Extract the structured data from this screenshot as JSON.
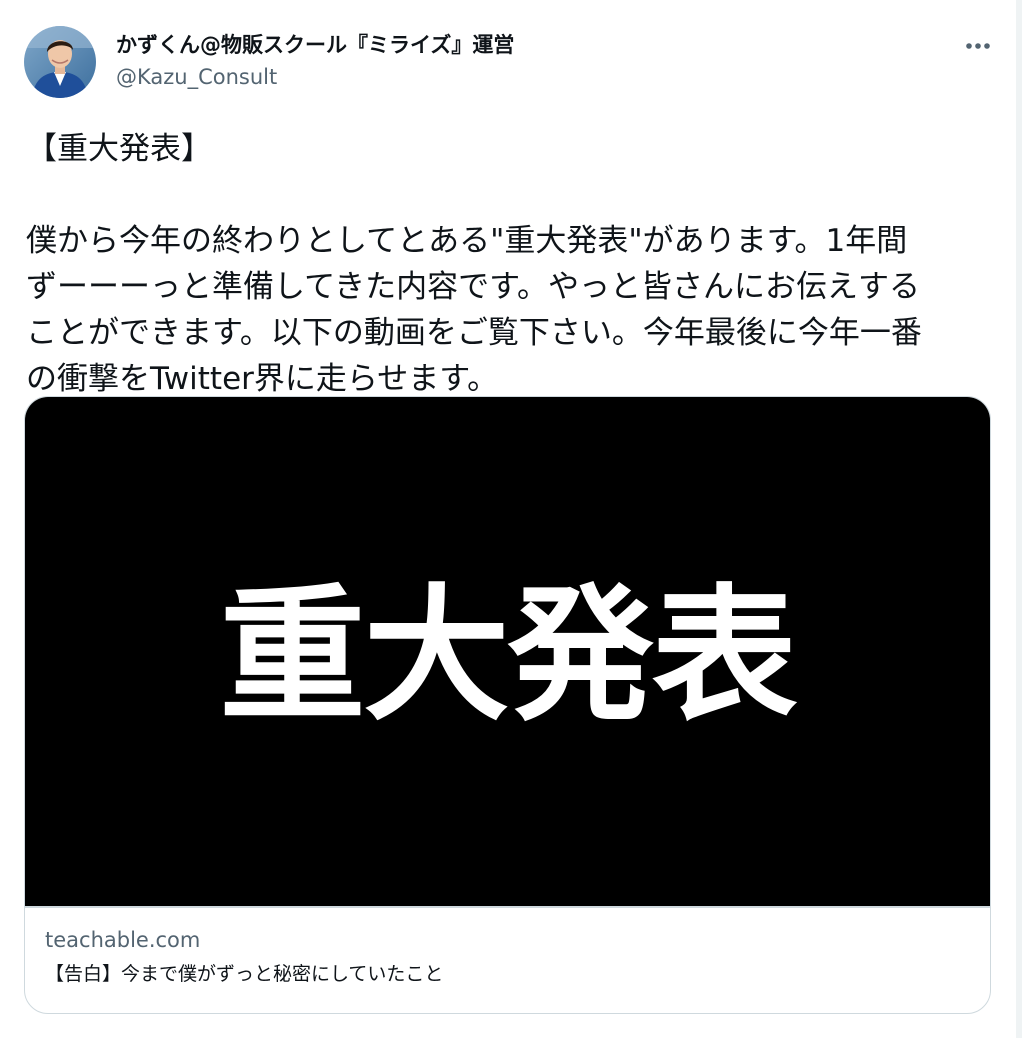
{
  "author": {
    "display_name": "かずくん@物販スクール『ミライズ』運営",
    "handle": "@Kazu_Consult",
    "avatar_icon": "profile-photo"
  },
  "more_icon": "more-horizontal-icon",
  "tweet": {
    "heading": "【重大発表】",
    "body": "僕から今年の終わりとしてとある\"重大発表\"があります。1年間\nずーーーっと準備してきた内容です。やっと皆さんにお伝えする\nことができます。以下の動画をご覧下さい。今年最後に今年一番\nの衝撃をTwitter界に走らせます。"
  },
  "card": {
    "media_text": "重大発表",
    "domain": "teachable.com",
    "title": "【告白】今まで僕がずっと秘密にしていたこと"
  },
  "colors": {
    "text_primary": "#0f1419",
    "text_secondary": "#536471",
    "border": "#cfd9de",
    "media_bg": "#000000"
  }
}
